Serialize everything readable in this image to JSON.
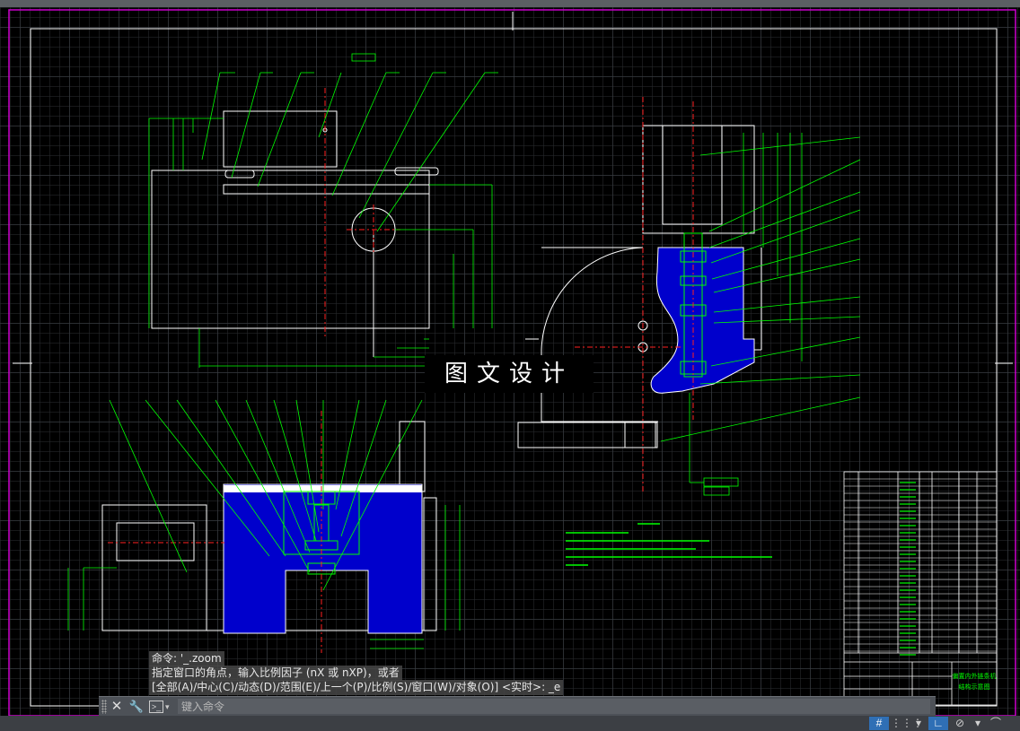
{
  "title_block": {
    "title_line1": "偏置内外链条机",
    "title_line2": "结构示意图"
  },
  "watermark": "图文设计",
  "command_history": [
    "命令: '_.zoom",
    "指定窗口的角点，输入比例因子 (nX 或 nXP)，或者",
    "[全部(A)/中心(C)/动态(D)/范围(E)/上一个(P)/比例(S)/窗口(W)/对象(O)] <实时>: _e"
  ],
  "command_input": {
    "placeholder": "键入命令",
    "value": ""
  },
  "icons": {
    "close": "close-icon",
    "settings": "wrench-icon",
    "prompt": "command-prompt-icon",
    "grid": "grid-icon",
    "snap": "snap-icon",
    "ortho": "ortho-icon",
    "polar": "polar-icon",
    "osnap": "osnap-icon"
  },
  "status_icons": [
    "#",
    "⋮⋮⋮",
    "▾",
    "∟",
    "⊘",
    "▾",
    "⌒"
  ],
  "colors": {
    "outline": "#ffffff",
    "leader": "#00ff00",
    "center": "#ff2020",
    "fill": "#0000cc",
    "border": "#cc00cc",
    "panel": "#4d5157",
    "status_active": "#2f6fb5"
  }
}
